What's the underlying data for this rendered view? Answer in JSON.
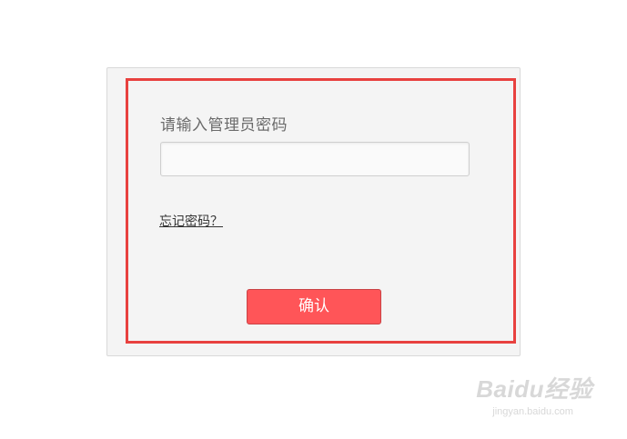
{
  "dialog": {
    "prompt": "请输入管理员密码",
    "password_value": "",
    "forgot_link": "忘记密码？",
    "confirm_label": "确认"
  },
  "watermark": {
    "logo_text": "Baidu经验",
    "url": "jingyan.baidu.com"
  },
  "colors": {
    "panel_bg": "#f4f4f4",
    "highlight_border": "#e8413f",
    "confirm_bg": "#ff5558",
    "text_gray": "#6a6a6a"
  }
}
